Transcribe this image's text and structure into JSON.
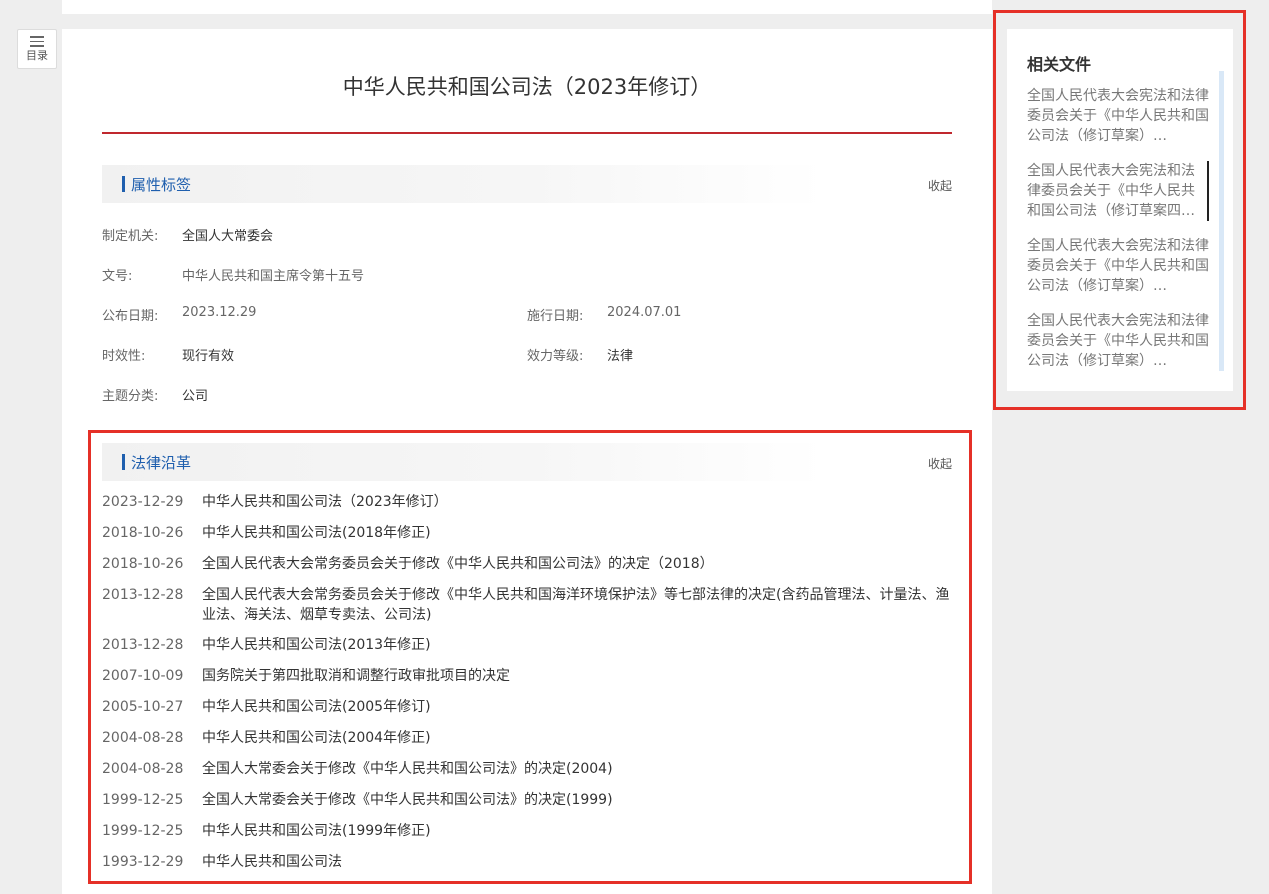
{
  "toc": {
    "label": "目录"
  },
  "document": {
    "title": "中华人民共和国公司法（2023年修订）"
  },
  "attributes_section": {
    "heading": "属性标签",
    "collapse_label": "收起",
    "fields": {
      "issuer": {
        "key": "制定机关:",
        "value": "全国人大常委会"
      },
      "doc_number": {
        "key": "文号:",
        "value": "中华人民共和国主席令第十五号"
      },
      "publish_date": {
        "key": "公布日期:",
        "value": "2023.12.29"
      },
      "effective_date": {
        "key": "施行日期:",
        "value": "2024.07.01"
      },
      "validity": {
        "key": "时效性:",
        "value": "现行有效"
      },
      "level": {
        "key": "效力等级:",
        "value": "法律"
      },
      "topic": {
        "key": "主题分类:",
        "value": "公司"
      }
    }
  },
  "history_section": {
    "heading": "法律沿革",
    "collapse_label": "收起",
    "items": [
      {
        "date": "2023-12-29",
        "name": "中华人民共和国公司法（2023年修订）"
      },
      {
        "date": "2018-10-26",
        "name": "中华人民共和国公司法(2018年修正)"
      },
      {
        "date": "2018-10-26",
        "name": "全国人民代表大会常务委员会关于修改《中华人民共和国公司法》的决定（2018）"
      },
      {
        "date": "2013-12-28",
        "name": "全国人民代表大会常务委员会关于修改《中华人民共和国海洋环境保护法》等七部法律的决定(含药品管理法、计量法、渔业法、海关法、烟草专卖法、公司法)"
      },
      {
        "date": "2013-12-28",
        "name": "中华人民共和国公司法(2013年修正)"
      },
      {
        "date": "2007-10-09",
        "name": "国务院关于第四批取消和调整行政审批项目的决定"
      },
      {
        "date": "2005-10-27",
        "name": "中华人民共和国公司法(2005年修订)"
      },
      {
        "date": "2004-08-28",
        "name": "中华人民共和国公司法(2004年修正)"
      },
      {
        "date": "2004-08-28",
        "name": "全国人大常委会关于修改《中华人民共和国公司法》的决定(2004)"
      },
      {
        "date": "1999-12-25",
        "name": "全国人大常委会关于修改《中华人民共和国公司法》的决定(1999)"
      },
      {
        "date": "1999-12-25",
        "name": "中华人民共和国公司法(1999年修正)"
      },
      {
        "date": "1993-12-29",
        "name": "中华人民共和国公司法"
      }
    ]
  },
  "related_files": {
    "heading": "相关文件",
    "items": [
      "全国人民代表大会宪法和法律委员会关于《中华人民共和国公司法（修订草案）…",
      "全国人民代表大会宪法和法律委员会关于《中华人民共和国公司法（修订草案四…",
      "全国人民代表大会宪法和法律委员会关于《中华人民共和国公司法（修订草案）…",
      "全国人民代表大会宪法和法律委员会关于《中华人民共和国公司法（修订草案）…"
    ]
  }
}
